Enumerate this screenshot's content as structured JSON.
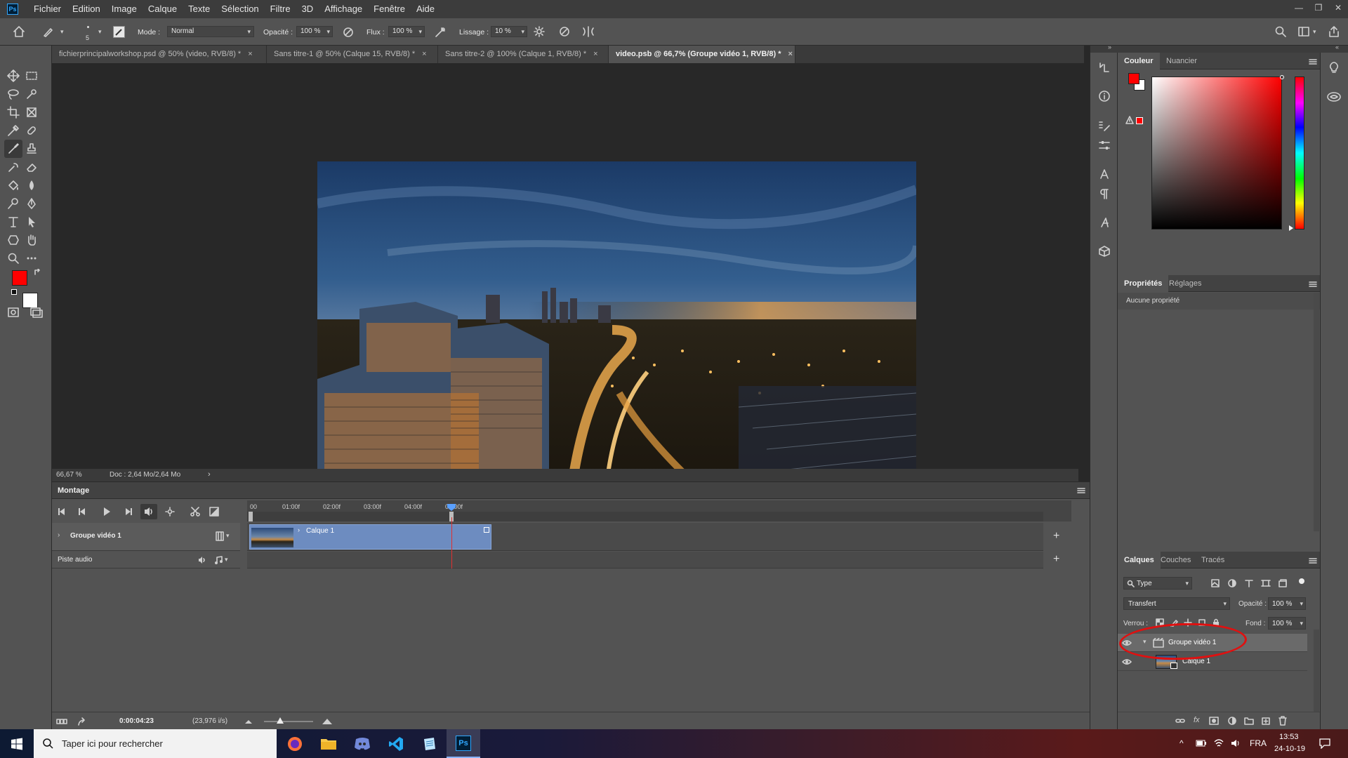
{
  "menubar": {
    "logo": "Ps",
    "items": [
      "Fichier",
      "Edition",
      "Image",
      "Calque",
      "Texte",
      "Sélection",
      "Filtre",
      "3D",
      "Affichage",
      "Fenêtre",
      "Aide"
    ],
    "min": "—",
    "restore": "❐",
    "close": "✕"
  },
  "options": {
    "brush_size": "5",
    "mode_label": "Mode :",
    "mode_value": "Normal",
    "opacity_label": "Opacité :",
    "opacity_value": "100 %",
    "flow_label": "Flux :",
    "flow_value": "100 %",
    "smoothing_label": "Lissage :",
    "smoothing_value": "10 %"
  },
  "tabs": [
    {
      "label": "fichierprincipalworkshop.psd @ 50% (video, RVB/8) *",
      "close": "×"
    },
    {
      "label": "Sans titre-1 @ 50% (Calque 15, RVB/8) *",
      "close": "×"
    },
    {
      "label": "Sans titre-2 @ 100% (Calque 1, RVB/8) *",
      "close": "×"
    },
    {
      "label": "video.psb @ 66,7% (Groupe vidéo 1, RVB/8) *",
      "close": "×"
    }
  ],
  "colors": {
    "foreground": "#ff0000",
    "background": "#ffffff",
    "accent": "#31a8ff",
    "hue_marker": "#ff1a1a"
  },
  "status": {
    "zoom": "66,67 %",
    "doc": "Doc : 2,64 Mo/2,64 Mo"
  },
  "timeline": {
    "title": "Montage",
    "ruler": [
      "00",
      "01:00f",
      "02:00f",
      "03:00f",
      "04:00f",
      "05:00f"
    ],
    "group_track": "Groupe vidéo 1",
    "clip_label": "Calque 1",
    "audio_track": "Piste audio",
    "timecode": "0:00:04:23",
    "fps": "(23,976 i/s)"
  },
  "color_panel": {
    "tabs": [
      "Couleur",
      "Nuancier"
    ]
  },
  "properties_panel": {
    "tabs": [
      "Propriétés",
      "Réglages"
    ],
    "empty_text": "Aucune propriété"
  },
  "layers_panel": {
    "tabs": [
      "Calques",
      "Couches",
      "Tracés"
    ],
    "filter": "Type",
    "blend_mode": "Transfert",
    "opacity_label": "Opacité :",
    "opacity_value": "100 %",
    "lock_label": "Verrou :",
    "fill_label": "Fond :",
    "fill_value": "100 %",
    "layers": [
      {
        "name": "Groupe vidéo 1"
      },
      {
        "name": "Calque 1"
      }
    ]
  },
  "taskbar": {
    "search_placeholder": "Taper ici pour rechercher",
    "lang": "FRA",
    "time": "13:53",
    "date": "24-10-19"
  }
}
